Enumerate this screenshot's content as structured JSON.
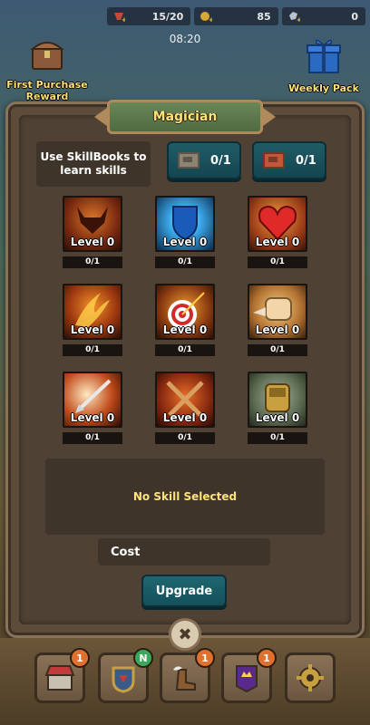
{
  "resources": [
    {
      "icon": "energy-icon",
      "value": "15/20"
    },
    {
      "icon": "gold-icon",
      "value": "85"
    },
    {
      "icon": "gem-icon",
      "value": "0"
    }
  ],
  "clock": "08:20",
  "first_purchase_label": "First Purchase Reward",
  "weekly_pack_label": "Weekly Pack",
  "panel_title": "Magician",
  "info_text": "Use SkillBooks to learn skills",
  "books": [
    {
      "icon": "grey-skillbook-icon",
      "count": "0/1"
    },
    {
      "icon": "red-skillbook-icon",
      "count": "0/1"
    }
  ],
  "skills": [
    {
      "icon": "demon-icon",
      "level": "Level 0",
      "count": "0/1"
    },
    {
      "icon": "shield-icon",
      "level": "Level 0",
      "count": "0/1"
    },
    {
      "icon": "heart-icon",
      "level": "Level 0",
      "count": "0/1"
    },
    {
      "icon": "fire-claw-icon",
      "level": "Level 0",
      "count": "0/1"
    },
    {
      "icon": "target-arrow-icon",
      "level": "Level 0",
      "count": "0/1"
    },
    {
      "icon": "fist-icon",
      "level": "Level 0",
      "count": "0/1"
    },
    {
      "icon": "arrow-strike-icon",
      "level": "Level 0",
      "count": "0/1"
    },
    {
      "icon": "crossed-swords-icon",
      "level": "Level 0",
      "count": "0/1"
    },
    {
      "icon": "gauntlet-icon",
      "level": "Level 0",
      "count": "0/1"
    }
  ],
  "description": "No Skill Selected",
  "cost_label": "Cost",
  "upgrade_label": "Upgrade",
  "close_symbol": "✖",
  "nav": [
    {
      "icon": "shop-icon",
      "badge": "1"
    },
    {
      "icon": "hero-helmet-icon",
      "badge": "N"
    },
    {
      "icon": "winged-boot-icon",
      "badge": "1"
    },
    {
      "icon": "guild-banner-icon",
      "badge": "1"
    },
    {
      "icon": "settings-gear-icon",
      "badge": ""
    }
  ]
}
